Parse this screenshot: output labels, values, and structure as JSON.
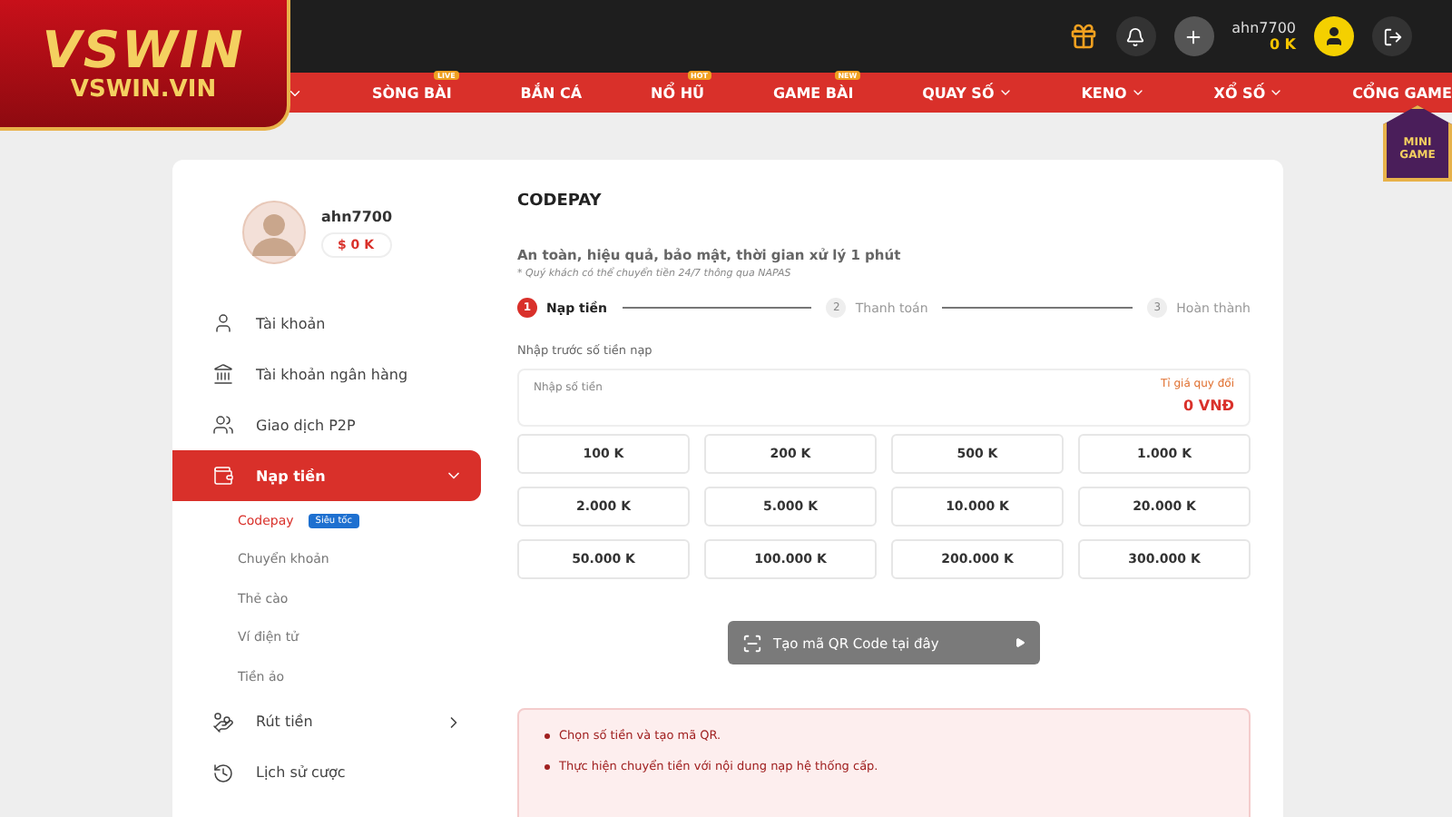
{
  "logo": {
    "brand": "VSWIN",
    "domain": "VSWIN.VIN"
  },
  "header": {
    "username": "ahn7700",
    "balance": "0 K"
  },
  "nav": [
    {
      "label": "SÒNG BÀI",
      "badge": "LIVE",
      "dropdown": false
    },
    {
      "label": "BẮN CÁ",
      "dropdown": false
    },
    {
      "label": "NỔ HŨ",
      "badge": "HOT",
      "dropdown": false
    },
    {
      "label": "GAME BÀI",
      "badge": "NEW",
      "dropdown": false
    },
    {
      "label": "QUAY SỐ",
      "dropdown": true
    },
    {
      "label": "KENO",
      "dropdown": true
    },
    {
      "label": "XỔ SỐ",
      "dropdown": true
    },
    {
      "label": "CỔNG GAME",
      "dropdown": false
    }
  ],
  "mini_game": {
    "label": "MINI GAME"
  },
  "profile": {
    "username": "ahn7700",
    "balance": "$ 0 K"
  },
  "sidebar": [
    {
      "kind": "user",
      "label": "Tài khoản",
      "selected": false
    },
    {
      "kind": "bank",
      "label": "Tài khoản ngân hàng",
      "selected": false
    },
    {
      "kind": "p2p",
      "label": "Giao dịch P2P",
      "selected": false
    },
    {
      "kind": "deposit",
      "label": "Nạp tiền",
      "selected": true,
      "expanded": true,
      "children": [
        {
          "label": "Codepay",
          "badge": "Siêu tốc",
          "selected": true
        },
        {
          "label": "Chuyển khoản",
          "selected": false
        },
        {
          "label": "Thẻ cào",
          "selected": false
        },
        {
          "label": "Ví điện tử",
          "selected": false
        },
        {
          "label": "Tiền ảo",
          "selected": false
        }
      ]
    },
    {
      "kind": "withdraw",
      "label": "Rút tiền",
      "selected": false,
      "expanded": false
    },
    {
      "kind": "history",
      "label": "Lịch sử cược",
      "selected": false
    }
  ],
  "main": {
    "title": "CODEPAY",
    "subtitle": "An toàn, hiệu quả, bảo mật, thời gian xử lý 1 phút",
    "note": "* Quý khách có thể chuyển tiền 24/7 thông qua NAPAS",
    "steps": [
      {
        "number": "1",
        "label": "Nạp tiền",
        "selected": true
      },
      {
        "number": "2",
        "label": "Thanh toán",
        "selected": false
      },
      {
        "number": "3",
        "label": "Hoàn thành",
        "selected": false
      }
    ],
    "amount_label": "Nhập trước số tiền nạp",
    "amount_field": {
      "placeholder": "Nhập số tiền",
      "rate_label": "Tỉ giá quy đổi",
      "rate_value": "0 VNĐ"
    },
    "amounts": [
      "100 K",
      "200 K",
      "500 K",
      "1.000 K",
      "2.000 K",
      "5.000 K",
      "10.000 K",
      "20.000 K",
      "50.000 K",
      "100.000 K",
      "200.000 K",
      "300.000 K"
    ],
    "qr_button": "Tạo mã QR Code tại đây",
    "instructions": [
      "Chọn số tiền và tạo mã QR.",
      "Thực hiện chuyển tiền với nội dung nạp hệ thống cấp."
    ]
  }
}
